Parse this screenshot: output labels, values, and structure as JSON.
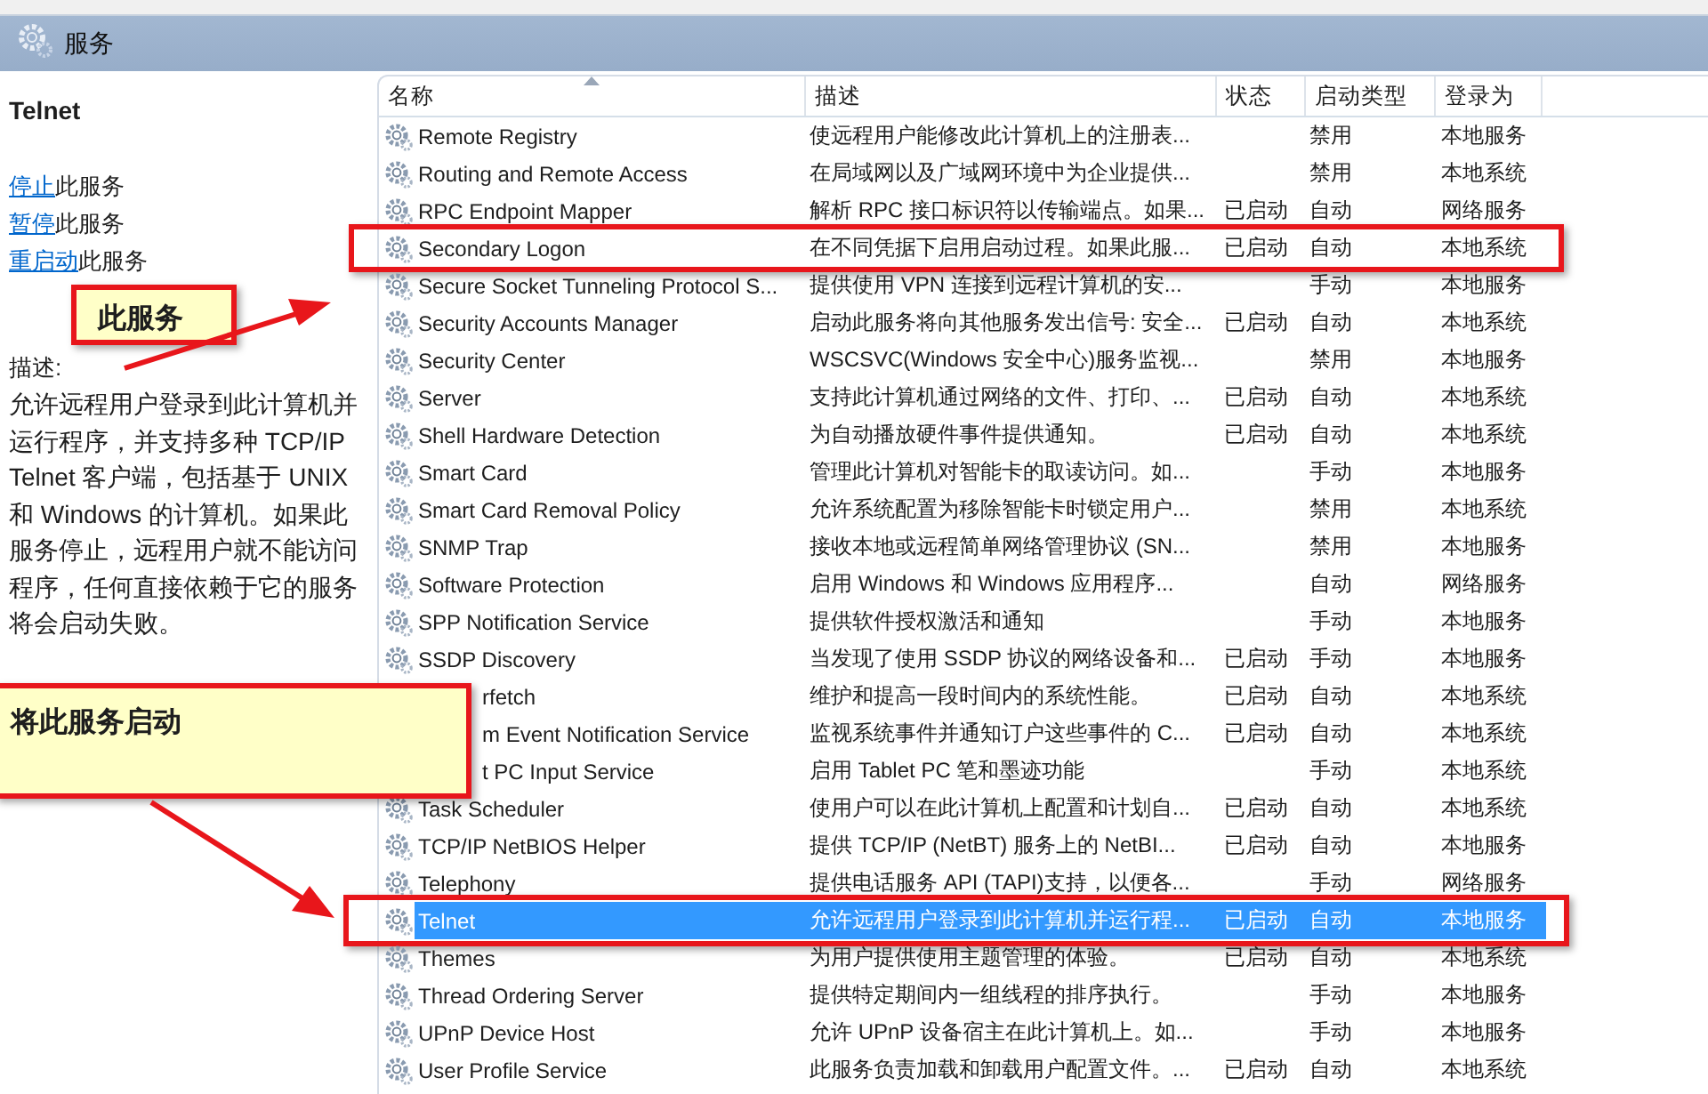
{
  "window": {
    "title": "服务"
  },
  "details": {
    "service_name": "Telnet",
    "actions": [
      {
        "link": "停止",
        "text": "此服务"
      },
      {
        "link": "暂停",
        "text": "此服务"
      },
      {
        "link": "重启动",
        "text": "此服务"
      }
    ],
    "description_label": "描述:",
    "description": "允许远程用户登录到此计算机并运行程序，并支持多种 TCP/IP Telnet 客户端，包括基于 UNIX 和 Windows 的计算机。如果此服务停止，远程用户就不能访问程序，任何直接依赖于它的服务将会启动失败。"
  },
  "table": {
    "columns": [
      {
        "label": "名称",
        "sorted": true
      },
      {
        "label": "描述",
        "sorted": false
      },
      {
        "label": "状态",
        "sorted": false
      },
      {
        "label": "启动类型",
        "sorted": false
      },
      {
        "label": "登录为",
        "sorted": false
      }
    ],
    "rows": [
      {
        "name": "Remote Registry",
        "description": "使远程用户能修改此计算机上的注册表...",
        "status": "",
        "startup_type": "禁用",
        "log_on_as": "本地服务",
        "selected": false,
        "covered": false,
        "framed": false
      },
      {
        "name": "Routing and Remote Access",
        "description": "在局域网以及广域网环境中为企业提供...",
        "status": "",
        "startup_type": "禁用",
        "log_on_as": "本地系统",
        "selected": false,
        "covered": false,
        "framed": false
      },
      {
        "name": "RPC Endpoint Mapper",
        "description": "解析 RPC 接口标识符以传输端点。如果...",
        "status": "已启动",
        "startup_type": "自动",
        "log_on_as": "网络服务",
        "selected": false,
        "covered": false,
        "framed": false
      },
      {
        "name": "Secondary Logon",
        "description": "在不同凭据下启用启动过程。如果此服...",
        "status": "已启动",
        "startup_type": "自动",
        "log_on_as": "本地系统",
        "selected": false,
        "covered": false,
        "framed": true
      },
      {
        "name": "Secure Socket Tunneling Protocol S...",
        "description": "提供使用 VPN 连接到远程计算机的安...",
        "status": "",
        "startup_type": "手动",
        "log_on_as": "本地服务",
        "selected": false,
        "covered": false,
        "framed": false
      },
      {
        "name": "Security Accounts Manager",
        "description": "启动此服务将向其他服务发出信号: 安全...",
        "status": "已启动",
        "startup_type": "自动",
        "log_on_as": "本地系统",
        "selected": false,
        "covered": false,
        "framed": false
      },
      {
        "name": "Security Center",
        "description": "WSCSVC(Windows 安全中心)服务监视...",
        "status": "",
        "startup_type": "禁用",
        "log_on_as": "本地服务",
        "selected": false,
        "covered": false,
        "framed": false
      },
      {
        "name": "Server",
        "description": "支持此计算机通过网络的文件、打印、...",
        "status": "已启动",
        "startup_type": "自动",
        "log_on_as": "本地系统",
        "selected": false,
        "covered": false,
        "framed": false
      },
      {
        "name": "Shell Hardware Detection",
        "description": "为自动播放硬件事件提供通知。",
        "status": "已启动",
        "startup_type": "自动",
        "log_on_as": "本地系统",
        "selected": false,
        "covered": false,
        "framed": false
      },
      {
        "name": "Smart Card",
        "description": "管理此计算机对智能卡的取读访问。如...",
        "status": "",
        "startup_type": "手动",
        "log_on_as": "本地服务",
        "selected": false,
        "covered": false,
        "framed": false
      },
      {
        "name": "Smart Card Removal Policy",
        "description": "允许系统配置为移除智能卡时锁定用户...",
        "status": "",
        "startup_type": "禁用",
        "log_on_as": "本地系统",
        "selected": false,
        "covered": false,
        "framed": false
      },
      {
        "name": "SNMP Trap",
        "description": "接收本地或远程简单网络管理协议 (SN...",
        "status": "",
        "startup_type": "禁用",
        "log_on_as": "本地服务",
        "selected": false,
        "covered": false,
        "framed": false
      },
      {
        "name": "Software Protection",
        "description": "启用 Windows 和 Windows 应用程序...",
        "status": "",
        "startup_type": "自动",
        "log_on_as": "网络服务",
        "selected": false,
        "covered": false,
        "framed": false
      },
      {
        "name": "SPP Notification Service",
        "description": "提供软件授权激活和通知",
        "status": "",
        "startup_type": "手动",
        "log_on_as": "本地服务",
        "selected": false,
        "covered": false,
        "framed": false
      },
      {
        "name": "SSDP Discovery",
        "description": "当发现了使用 SSDP 协议的网络设备和...",
        "status": "已启动",
        "startup_type": "手动",
        "log_on_as": "本地服务",
        "selected": false,
        "covered": false,
        "framed": false
      },
      {
        "name": "rfetch",
        "description": "维护和提高一段时间内的系统性能。",
        "status": "已启动",
        "startup_type": "自动",
        "log_on_as": "本地系统",
        "selected": false,
        "covered": true,
        "framed": false
      },
      {
        "name": "m Event Notification Service",
        "description": "监视系统事件并通知订户这些事件的 C...",
        "status": "已启动",
        "startup_type": "自动",
        "log_on_as": "本地系统",
        "selected": false,
        "covered": true,
        "framed": false
      },
      {
        "name": "t PC Input Service",
        "description": "启用 Tablet PC 笔和墨迹功能",
        "status": "",
        "startup_type": "手动",
        "log_on_as": "本地系统",
        "selected": false,
        "covered": true,
        "framed": false
      },
      {
        "name": "Task Scheduler",
        "description": "使用户可以在此计算机上配置和计划自...",
        "status": "已启动",
        "startup_type": "自动",
        "log_on_as": "本地系统",
        "selected": false,
        "covered": false,
        "framed": false
      },
      {
        "name": "TCP/IP NetBIOS Helper",
        "description": "提供 TCP/IP (NetBT) 服务上的 NetBI...",
        "status": "已启动",
        "startup_type": "自动",
        "log_on_as": "本地服务",
        "selected": false,
        "covered": false,
        "framed": false
      },
      {
        "name": "Telephony",
        "description": "提供电话服务 API (TAPI)支持，以便各...",
        "status": "",
        "startup_type": "手动",
        "log_on_as": "网络服务",
        "selected": false,
        "covered": false,
        "framed": false
      },
      {
        "name": "Telnet",
        "description": "允许远程用户登录到此计算机并运行程...",
        "status": "已启动",
        "startup_type": "自动",
        "log_on_as": "本地服务",
        "selected": true,
        "covered": false,
        "framed": true
      },
      {
        "name": "Themes",
        "description": "为用户提供使用主题管理的体验。",
        "status": "已启动",
        "startup_type": "自动",
        "log_on_as": "本地系统",
        "selected": false,
        "covered": false,
        "framed": false
      },
      {
        "name": "Thread Ordering Server",
        "description": "提供特定期间内一组线程的排序执行。",
        "status": "",
        "startup_type": "手动",
        "log_on_as": "本地服务",
        "selected": false,
        "covered": false,
        "framed": false
      },
      {
        "name": "UPnP Device Host",
        "description": "允许 UPnP 设备宿主在此计算机上。如...",
        "status": "",
        "startup_type": "手动",
        "log_on_as": "本地服务",
        "selected": false,
        "covered": false,
        "framed": false
      },
      {
        "name": "User Profile Service",
        "description": "此服务负责加载和卸载用户配置文件。...",
        "status": "已启动",
        "startup_type": "自动",
        "log_on_as": "本地系统",
        "selected": false,
        "covered": false,
        "framed": false
      }
    ]
  },
  "annotations": [
    {
      "text": "此服务"
    },
    {
      "text": "将此服务启动"
    }
  ]
}
